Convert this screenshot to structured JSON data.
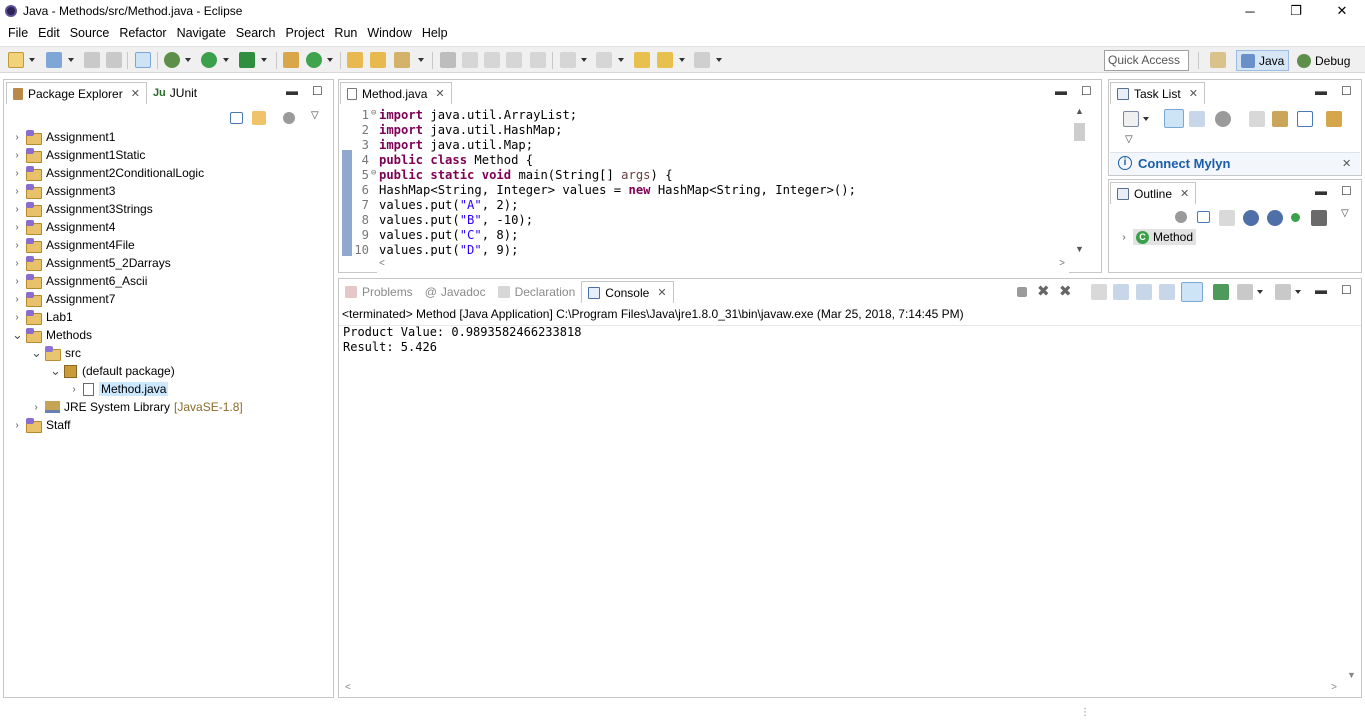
{
  "window": {
    "title": "Java - Methods/src/Method.java - Eclipse"
  },
  "menu": [
    "File",
    "Edit",
    "Source",
    "Refactor",
    "Navigate",
    "Search",
    "Project",
    "Run",
    "Window",
    "Help"
  ],
  "toolbar": {
    "quick_access_placeholder": "Quick Access",
    "perspectives": [
      {
        "label": "Java",
        "active": true
      },
      {
        "label": "Debug",
        "active": false
      }
    ]
  },
  "package_explorer": {
    "tabs": [
      {
        "label": "Package Explorer",
        "active": true,
        "closeable": true
      },
      {
        "label": "JUnit",
        "active": false
      }
    ],
    "tree": [
      {
        "label": "Assignment1",
        "expanded": false,
        "level": 0,
        "icon": "java-project-icon"
      },
      {
        "label": "Assignment1Static",
        "expanded": false,
        "level": 0,
        "icon": "java-project-icon"
      },
      {
        "label": "Assignment2ConditionalLogic",
        "expanded": false,
        "level": 0,
        "icon": "java-project-icon"
      },
      {
        "label": "Assignment3",
        "expanded": false,
        "level": 0,
        "icon": "java-project-icon"
      },
      {
        "label": "Assignment3Strings",
        "expanded": false,
        "level": 0,
        "icon": "java-project-icon"
      },
      {
        "label": "Assignment4",
        "expanded": false,
        "level": 0,
        "icon": "java-project-icon"
      },
      {
        "label": "Assignment4File",
        "expanded": false,
        "level": 0,
        "icon": "java-project-icon"
      },
      {
        "label": "Assignment5_2Darrays",
        "expanded": false,
        "level": 0,
        "icon": "java-project-icon"
      },
      {
        "label": "Assignment6_Ascii",
        "expanded": false,
        "level": 0,
        "icon": "java-project-icon"
      },
      {
        "label": "Assignment7",
        "expanded": false,
        "level": 0,
        "icon": "java-project-icon"
      },
      {
        "label": "Lab1",
        "expanded": false,
        "level": 0,
        "icon": "java-project-icon"
      },
      {
        "label": "Methods",
        "expanded": true,
        "level": 0,
        "icon": "java-project-icon"
      },
      {
        "label": "src",
        "expanded": true,
        "level": 1,
        "icon": "source-folder-icon"
      },
      {
        "label": "(default package)",
        "expanded": true,
        "level": 2,
        "icon": "package-icon"
      },
      {
        "label": "Method.java",
        "expanded": false,
        "level": 3,
        "icon": "java-file-icon",
        "selected": true
      },
      {
        "label": "JRE System Library",
        "suffix": "[JavaSE-1.8]",
        "expanded": false,
        "level": 1,
        "icon": "library-icon"
      },
      {
        "label": "Staff",
        "expanded": false,
        "level": 0,
        "icon": "java-project-icon"
      }
    ]
  },
  "editor": {
    "tab_label": "Method.java",
    "lines": [
      {
        "n": "1",
        "mark": "⊖",
        "tokens": [
          {
            "t": "import",
            "c": "kw"
          },
          {
            "t": " java.util.ArrayList;",
            "c": ""
          }
        ]
      },
      {
        "n": "2",
        "mark": "",
        "tokens": [
          {
            "t": "import",
            "c": "kw"
          },
          {
            "t": " java.util.HashMap;",
            "c": ""
          }
        ]
      },
      {
        "n": "3",
        "mark": "",
        "tokens": [
          {
            "t": "import",
            "c": "kw"
          },
          {
            "t": " java.util.Map;",
            "c": ""
          }
        ]
      },
      {
        "n": "4",
        "mark": "",
        "tokens": [
          {
            "t": "public",
            "c": "kw"
          },
          {
            "t": " ",
            "c": ""
          },
          {
            "t": "class",
            "c": "kw"
          },
          {
            "t": " Method {",
            "c": ""
          }
        ]
      },
      {
        "n": "5",
        "mark": "⊖",
        "tokens": [
          {
            "t": "public",
            "c": "kw"
          },
          {
            "t": " ",
            "c": ""
          },
          {
            "t": "static",
            "c": "kw"
          },
          {
            "t": " ",
            "c": ""
          },
          {
            "t": "void",
            "c": "kw"
          },
          {
            "t": " main(String[] ",
            "c": ""
          },
          {
            "t": "args",
            "c": "ovr"
          },
          {
            "t": ") {",
            "c": ""
          }
        ]
      },
      {
        "n": "6",
        "mark": "",
        "tokens": [
          {
            "t": "HashMap<String, Integer> values = ",
            "c": ""
          },
          {
            "t": "new",
            "c": "kw"
          },
          {
            "t": " HashMap<String, Integer>();",
            "c": ""
          }
        ]
      },
      {
        "n": "7",
        "mark": "",
        "tokens": [
          {
            "t": "values.put(",
            "c": ""
          },
          {
            "t": "\"A\"",
            "c": "str"
          },
          {
            "t": ", 2);",
            "c": ""
          }
        ]
      },
      {
        "n": "8",
        "mark": "",
        "tokens": [
          {
            "t": "values.put(",
            "c": ""
          },
          {
            "t": "\"B\"",
            "c": "str"
          },
          {
            "t": ", -10);",
            "c": ""
          }
        ]
      },
      {
        "n": "9",
        "mark": "",
        "tokens": [
          {
            "t": "values.put(",
            "c": ""
          },
          {
            "t": "\"C\"",
            "c": "str"
          },
          {
            "t": ", 8);",
            "c": ""
          }
        ]
      },
      {
        "n": "10",
        "mark": "",
        "tokens": [
          {
            "t": "values.put(",
            "c": ""
          },
          {
            "t": "\"D\"",
            "c": "str"
          },
          {
            "t": ", 9);",
            "c": ""
          }
        ]
      }
    ]
  },
  "bottom_panel": {
    "tabs": [
      {
        "label": "Problems",
        "active": false
      },
      {
        "label": "Javadoc",
        "active": false
      },
      {
        "label": "Declaration",
        "active": false
      },
      {
        "label": "Console",
        "active": true,
        "closeable": true
      }
    ],
    "console": {
      "header": "<terminated> Method [Java Application] C:\\Program Files\\Java\\jre1.8.0_31\\bin\\javaw.exe (Mar 25, 2018, 7:14:45 PM)",
      "output": [
        "Product Value: 0.9893582466233818",
        "Result: 5.426"
      ]
    }
  },
  "task_list": {
    "tab_label": "Task List",
    "connect_label": "Connect Mylyn"
  },
  "outline": {
    "tab_label": "Outline",
    "items": [
      {
        "label": "Method"
      }
    ]
  },
  "colors": {
    "keyword": "#7f0055",
    "string": "#2a00ff",
    "selection": "#cce8ff",
    "tab_border": "#c7c7c7",
    "link": "#1a5dab"
  }
}
